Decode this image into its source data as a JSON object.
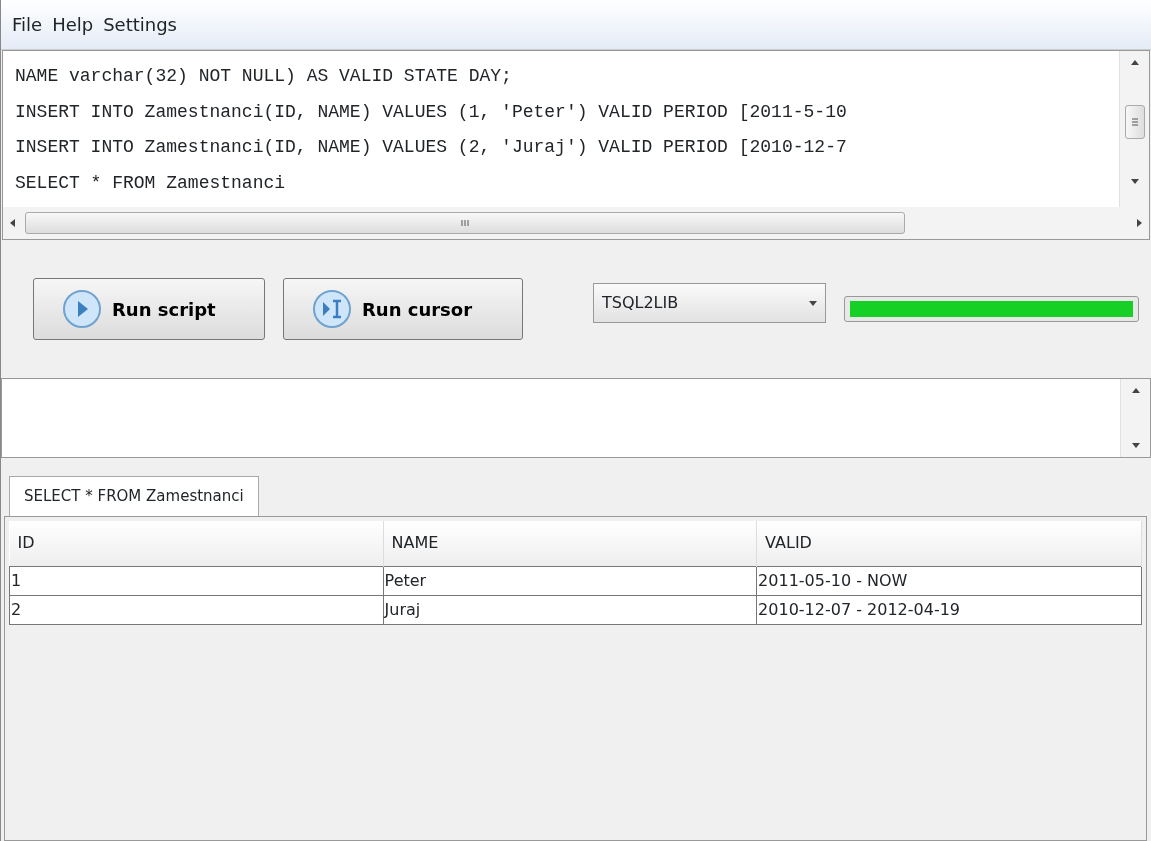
{
  "menu": [
    "File",
    "Help",
    "Settings"
  ],
  "editor": {
    "lines": [
      "NAME varchar(32) NOT NULL) AS VALID STATE DAY;",
      "INSERT INTO Zamestnanci(ID, NAME) VALUES (1, 'Peter') VALID PERIOD [2011-5-10",
      "INSERT INTO Zamestnanci(ID, NAME) VALUES (2, 'Juraj') VALID PERIOD [2010-12-7",
      "SELECT * FROM Zamestnanci"
    ]
  },
  "toolbar": {
    "buttons": [
      {
        "label": "Run script",
        "kind": "play"
      },
      {
        "label": "Run cursor",
        "kind": "cursor"
      }
    ],
    "library": {
      "value": "TSQL2LIB"
    },
    "progress": {
      "level": 1
    }
  },
  "tabs": [
    {
      "label": "SELECT * FROM Zamestnanci",
      "selected": true
    }
  ],
  "table": {
    "columns": [
      "ID",
      "NAME",
      "VALID"
    ],
    "rows": [
      [
        "1",
        "Peter",
        "2011-05-10 - NOW"
      ],
      [
        "2",
        "Juraj",
        "2010-12-07 - 2012-04-19"
      ]
    ]
  }
}
